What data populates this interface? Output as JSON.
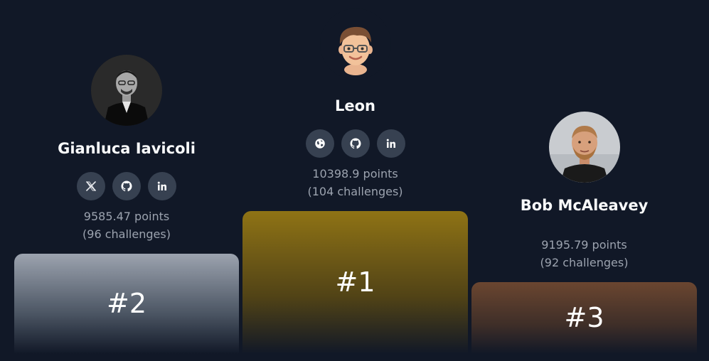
{
  "podium": [
    {
      "rank_label": "#2",
      "name": "Gianluca Iavicoli",
      "points": "9585.47 points",
      "challenges": "(96 challenges)",
      "socials": [
        "x-icon",
        "github-icon",
        "linkedin-icon"
      ]
    },
    {
      "rank_label": "#1",
      "name": "Leon",
      "points": "10398.9 points",
      "challenges": "(104 challenges)",
      "socials": [
        "globe-icon",
        "github-icon",
        "linkedin-icon"
      ]
    },
    {
      "rank_label": "#3",
      "name": "Bob McAleavey",
      "points": "9195.79 points",
      "challenges": "(92 challenges)",
      "socials": []
    }
  ],
  "colors": {
    "background": "#111827",
    "social_button": "#374151",
    "silver": "#9ca3af",
    "gold": "#8f7315",
    "bronze": "#6b4630"
  }
}
